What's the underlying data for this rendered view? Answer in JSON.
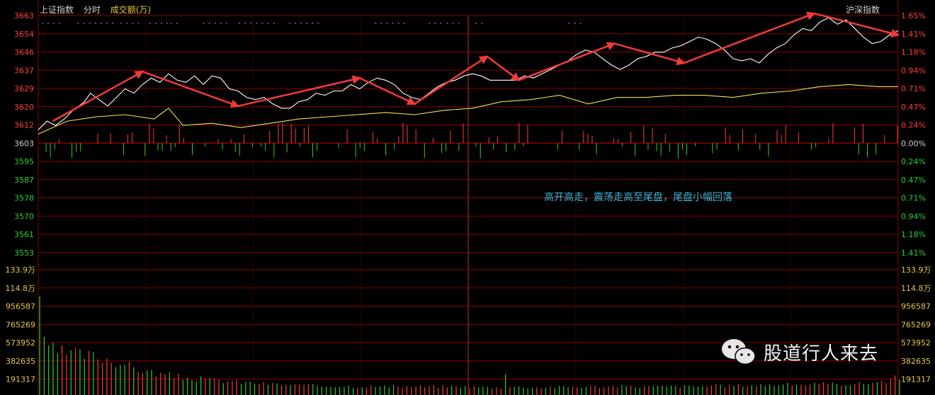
{
  "header": {
    "index_name": "上证指数",
    "mode": "分时",
    "amount_label": "成交额(万)",
    "compare_index": "沪深指数"
  },
  "annotation": "高开高走，震荡走高至尾盘，尾盘小幅回落",
  "watermark": "股道行人来去",
  "colors": {
    "background": "#000000",
    "grid": "#8a0000",
    "up": "#ff3c3c",
    "down": "#2bd12b",
    "price_line": "#ffffff",
    "avg_line": "#e8e84a",
    "arrow": "#f03a3a",
    "marker": "#d040f0",
    "label_text": "#c8c8c8"
  },
  "chart_data": {
    "type": "line",
    "subtype": "intraday time-sharing chart with amount bars",
    "base_price": 3603,
    "price_axis": {
      "ticks": [
        "3663",
        "3654",
        "3646",
        "3637",
        "3629",
        "3620",
        "3612",
        "3603",
        "3595",
        "3587",
        "3578",
        "3570",
        "3561",
        "3553"
      ],
      "pct_ticks": [
        "1.65%",
        "1.41%",
        "1.18%",
        "0.94%",
        "0.71%",
        "0.47%",
        "0.24%",
        "0.00%",
        "0.24%",
        "0.47%",
        "0.71%",
        "0.94%",
        "1.18%",
        "1.41%"
      ],
      "ylim": [
        3553,
        3663
      ]
    },
    "amount_axis": {
      "ticks": [
        "133.9万",
        "114.8万",
        "956587",
        "765269",
        "573952",
        "382635",
        "191317"
      ],
      "ylim": [
        0,
        1339000
      ]
    },
    "x": {
      "session_minutes": 240,
      "grid_every_minutes": 30
    },
    "series": [
      {
        "key": "price",
        "color": "#ffffff",
        "points": [
          [
            0,
            3610
          ],
          [
            3,
            3614
          ],
          [
            6,
            3612
          ],
          [
            9,
            3615
          ],
          [
            12,
            3619
          ],
          [
            16,
            3623
          ],
          [
            18,
            3627
          ],
          [
            21,
            3624
          ],
          [
            24,
            3621
          ],
          [
            27,
            3625
          ],
          [
            30,
            3629
          ],
          [
            33,
            3627
          ],
          [
            36,
            3631
          ],
          [
            39,
            3634
          ],
          [
            42,
            3632
          ],
          [
            45,
            3636
          ],
          [
            48,
            3633
          ],
          [
            51,
            3632
          ],
          [
            54,
            3635
          ],
          [
            57,
            3631
          ],
          [
            60,
            3635
          ],
          [
            63,
            3634
          ],
          [
            66,
            3629
          ],
          [
            69,
            3628
          ],
          [
            72,
            3625
          ],
          [
            75,
            3624
          ],
          [
            78,
            3625
          ],
          [
            81,
            3622
          ],
          [
            84,
            3620
          ],
          [
            87,
            3620
          ],
          [
            90,
            3623
          ],
          [
            93,
            3624
          ],
          [
            96,
            3627
          ],
          [
            99,
            3626
          ],
          [
            102,
            3628
          ],
          [
            105,
            3628
          ],
          [
            108,
            3631
          ],
          [
            111,
            3629
          ],
          [
            114,
            3632
          ],
          [
            117,
            3634
          ],
          [
            120,
            3633
          ],
          [
            123,
            3631
          ],
          [
            126,
            3627
          ],
          [
            129,
            3625
          ],
          [
            132,
            3624
          ],
          [
            135,
            3627
          ],
          [
            138,
            3630
          ],
          [
            141,
            3632
          ],
          [
            144,
            3633
          ],
          [
            147,
            3635
          ],
          [
            150,
            3636
          ],
          [
            153,
            3635
          ],
          [
            156,
            3633
          ],
          [
            159,
            3633
          ],
          [
            162,
            3633
          ],
          [
            165,
            3633
          ],
          [
            168,
            3635
          ],
          [
            171,
            3634
          ],
          [
            174,
            3636
          ],
          [
            177,
            3638
          ],
          [
            180,
            3640
          ],
          [
            183,
            3642
          ],
          [
            186,
            3645
          ],
          [
            189,
            3647
          ],
          [
            192,
            3646
          ],
          [
            195,
            3643
          ],
          [
            198,
            3640
          ],
          [
            201,
            3638
          ],
          [
            204,
            3640
          ],
          [
            207,
            3643
          ],
          [
            210,
            3644
          ],
          [
            213,
            3646
          ],
          [
            216,
            3646
          ],
          [
            219,
            3648
          ],
          [
            222,
            3649
          ],
          [
            225,
            3651
          ],
          [
            228,
            3653
          ],
          [
            231,
            3652
          ],
          [
            234,
            3650
          ],
          [
            237,
            3647
          ],
          [
            240,
            3643
          ],
          [
            243,
            3642
          ],
          [
            246,
            3643
          ],
          [
            249,
            3641
          ],
          [
            252,
            3645
          ],
          [
            255,
            3648
          ],
          [
            258,
            3650
          ],
          [
            261,
            3654
          ],
          [
            264,
            3657
          ],
          [
            267,
            3656
          ],
          [
            270,
            3660
          ],
          [
            273,
            3662
          ],
          [
            276,
            3659
          ],
          [
            279,
            3661
          ],
          [
            282,
            3657
          ],
          [
            285,
            3653
          ],
          [
            288,
            3650
          ],
          [
            291,
            3651
          ],
          [
            294,
            3654
          ],
          [
            297,
            3656
          ]
        ],
        "time_scale": 0.8080808
      },
      {
        "key": "average",
        "color": "#e8e84a",
        "points": [
          [
            0,
            3608
          ],
          [
            10,
            3614
          ],
          [
            20,
            3616
          ],
          [
            30,
            3617
          ],
          [
            40,
            3615
          ],
          [
            45,
            3620
          ],
          [
            50,
            3612
          ],
          [
            60,
            3613
          ],
          [
            70,
            3611
          ],
          [
            80,
            3613
          ],
          [
            90,
            3615
          ],
          [
            100,
            3616
          ],
          [
            110,
            3617
          ],
          [
            120,
            3618
          ],
          [
            130,
            3617
          ],
          [
            140,
            3619
          ],
          [
            150,
            3620
          ],
          [
            160,
            3623
          ],
          [
            170,
            3624
          ],
          [
            180,
            3626
          ],
          [
            190,
            3622
          ],
          [
            200,
            3625
          ],
          [
            210,
            3625
          ],
          [
            220,
            3626
          ],
          [
            230,
            3626
          ],
          [
            240,
            3625
          ],
          [
            250,
            3627
          ],
          [
            260,
            3628
          ],
          [
            270,
            3630
          ],
          [
            280,
            3631
          ],
          [
            290,
            3630
          ],
          [
            297,
            3630
          ]
        ],
        "time_scale": 0.8080808
      }
    ],
    "arrows": [
      [
        [
          5,
          3614
        ],
        [
          36,
          3637
        ]
      ],
      [
        [
          36,
          3637
        ],
        [
          69,
          3621
        ]
      ],
      [
        [
          69,
          3621
        ],
        [
          111,
          3634
        ]
      ],
      [
        [
          111,
          3634
        ],
        [
          130,
          3622
        ]
      ],
      [
        [
          130,
          3622
        ],
        [
          155,
          3644
        ]
      ],
      [
        [
          155,
          3644
        ],
        [
          166,
          3633
        ]
      ],
      [
        [
          166,
          3633
        ],
        [
          199,
          3650
        ]
      ],
      [
        [
          199,
          3650
        ],
        [
          223,
          3641
        ]
      ],
      [
        [
          223,
          3641
        ],
        [
          268,
          3664
        ]
      ],
      [
        [
          268,
          3664
        ],
        [
          297,
          3654
        ]
      ]
    ],
    "arrow_time_scale": 0.8080808,
    "amount_profile": [
      [
        0,
        1150000
      ],
      [
        1,
        560000
      ],
      [
        3,
        500000
      ],
      [
        6,
        470000
      ],
      [
        10,
        450000
      ],
      [
        14,
        430000
      ],
      [
        18,
        410000
      ],
      [
        22,
        360000
      ],
      [
        26,
        300000
      ],
      [
        30,
        260000
      ],
      [
        35,
        220000
      ],
      [
        40,
        190000
      ],
      [
        50,
        160000
      ],
      [
        60,
        130000
      ],
      [
        70,
        110000
      ],
      [
        80,
        100000
      ],
      [
        90,
        95000
      ],
      [
        100,
        92000
      ],
      [
        110,
        95000
      ],
      [
        120,
        90000
      ],
      [
        129,
        80000
      ],
      [
        130,
        270000
      ],
      [
        131,
        90000
      ],
      [
        140,
        85000
      ],
      [
        150,
        90000
      ],
      [
        160,
        95000
      ],
      [
        170,
        92000
      ],
      [
        180,
        95000
      ],
      [
        190,
        100000
      ],
      [
        200,
        110000
      ],
      [
        210,
        115000
      ],
      [
        220,
        120000
      ],
      [
        230,
        125000
      ],
      [
        237,
        160000
      ],
      [
        240,
        200000
      ]
    ]
  }
}
